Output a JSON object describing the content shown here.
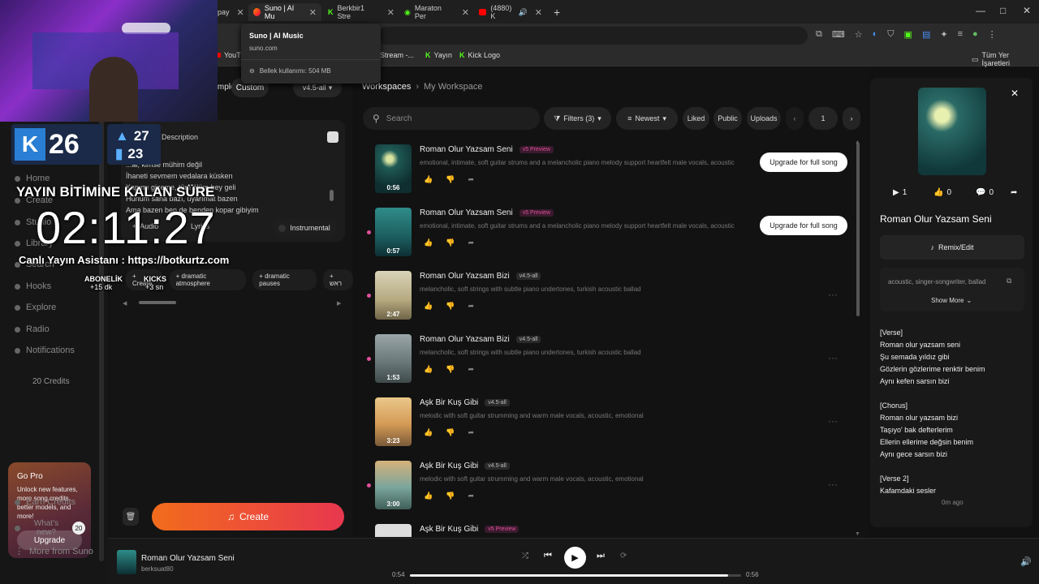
{
  "tabs": [
    {
      "label": "pay"
    },
    {
      "label": "Suno | AI Mu"
    },
    {
      "label": "Berkbir1 Stre"
    },
    {
      "label": "Maraton Per"
    },
    {
      "label": "(4880) K"
    }
  ],
  "tooltip": {
    "title": "Suno | AI Music",
    "url": "suno.com",
    "memory": "Bellek kullanımı: 504 MB"
  },
  "bookmarks": [
    {
      "label": "YouTu"
    },
    {
      "label": "Stream -..."
    },
    {
      "label": "Yayın"
    },
    {
      "label": "Kick Logo"
    }
  ],
  "bookmarks_right": "Tüm Yer İşaretleri",
  "overlay": {
    "kick_count": "26",
    "likes": "27",
    "viewers": "23",
    "countdown_label": "YAYIN BİTİMİNE KALAN SÜRE",
    "countdown": "02:11:27",
    "assistant": "Canlı Yayın Asistanı : https://botkurtz.com",
    "sub_label": "ABONELİK",
    "sub_value": "+15 dk",
    "kicks_label": "KICKS",
    "kicks_value": "+3 sn"
  },
  "sidebar": {
    "items": [
      {
        "label": "Home"
      },
      {
        "label": "Create"
      },
      {
        "label": "Studio"
      },
      {
        "label": "Library"
      },
      {
        "label": "Search"
      },
      {
        "label": "Hooks"
      },
      {
        "label": "Explore"
      },
      {
        "label": "Radio"
      },
      {
        "label": "Notifications"
      }
    ],
    "credits": "20 Credits",
    "gopro": {
      "title": "Go Pro",
      "text": "Unlock new features, more song credits, better models, and more!",
      "button": "Upgrade"
    },
    "earn": "Earn Credits",
    "whats_new": "What's new?",
    "whats_new_count": "20",
    "more": "More from Suno"
  },
  "midcol": {
    "mode_simple": "Simple",
    "mode_custom": "Custom",
    "model": "v4.5-all",
    "desc_label": "Description",
    "lyrics": [
      "...al, kimse mühim değil",
      "İhaneti sevmem vedalara küsken",
      "Kapımı gizeme, tüm ölüm bey geli",
      "Hunum sana bazı, uyarımat bazen",
      "Ama bazen ben de benden kopar gibiyim"
    ],
    "audio": "Audio",
    "lyrics_btn": "Lyrics",
    "instrumental": "Instrumental",
    "chips": [
      "Create",
      "dramatic atmosphere",
      "dramatic pauses",
      "ראש"
    ],
    "create_btn": "Create"
  },
  "main": {
    "breadcrumb": {
      "root": "Workspaces",
      "current": "My Workspace"
    },
    "search_placeholder": "Search",
    "filters": "Filters (3)",
    "sort": "Newest",
    "liked": "Liked",
    "public": "Public",
    "uploads": "Uploads",
    "page": "1",
    "songs": [
      {
        "title": "Roman Olur Yazsam Seni",
        "badge": "v5 Preview",
        "desc": "emotional, intimate, soft guitar strums and a melancholic piano melody support heartfelt male vocals, acoustic",
        "dur": "0:56",
        "upgrade": "Upgrade for full song"
      },
      {
        "title": "Roman Olur Yazsam Seni",
        "badge": "v5 Preview",
        "desc": "emotional, intimate, soft guitar strums and a melancholic piano melody support heartfelt male vocals, acoustic",
        "dur": "0:57",
        "upgrade": "Upgrade for full song"
      },
      {
        "title": "Roman Olur Yazsam Bizi",
        "badge": "v4.5-all",
        "desc": "melancholic, soft strings with subtle piano undertones, turkish acoustic ballad",
        "dur": "2:47",
        "upgrade": ""
      },
      {
        "title": "Roman Olur Yazsam Bizi",
        "badge": "v4.5-all",
        "desc": "melancholic, soft strings with subtle piano undertones, turkish acoustic ballad",
        "dur": "1:53",
        "upgrade": ""
      },
      {
        "title": "Aşk Bir Kuş Gibi",
        "badge": "v4.5-all",
        "desc": "melodic with soft guitar strumming and warm male vocals, acoustic, emotional",
        "dur": "3:23",
        "upgrade": ""
      },
      {
        "title": "Aşk Bir Kuş Gibi",
        "badge": "v4.5-all",
        "desc": "melodic with soft guitar strumming and warm male vocals, acoustic, emotional",
        "dur": "3:00",
        "upgrade": ""
      },
      {
        "title": "Aşk Bir Kuş Gibi",
        "badge": "v5 Preview",
        "desc": "",
        "dur": "",
        "upgrade": ""
      }
    ]
  },
  "right": {
    "plays": "1",
    "likes": "0",
    "comments": "0",
    "title": "Roman Olur Yazsam Seni",
    "remix": "Remix/Edit",
    "tags": "acoustic, singer-songwriter, ballad",
    "show_more": "Show More",
    "lyrics": [
      "[Verse]",
      "Roman olur yazsam seni",
      "Şu semada yıldız gibi",
      "Gözlerin gözlerime renktir benim",
      "Aynı kefen sarsın bizi",
      "",
      "[Chorus]",
      "Roman olur yazsam bizi",
      "Taşıyo' bak defterlerim",
      "Ellerin ellerime değsin benim",
      "Aynı gece sarsın bizi",
      "",
      "[Verse 2]",
      "Kafamdaki sesler"
    ],
    "time": "0m ago"
  },
  "player": {
    "title": "Roman Olur Yazsam Seni",
    "artist": "berksuat80",
    "current": "0:54",
    "total": "0:56",
    "progress": 0.96
  }
}
